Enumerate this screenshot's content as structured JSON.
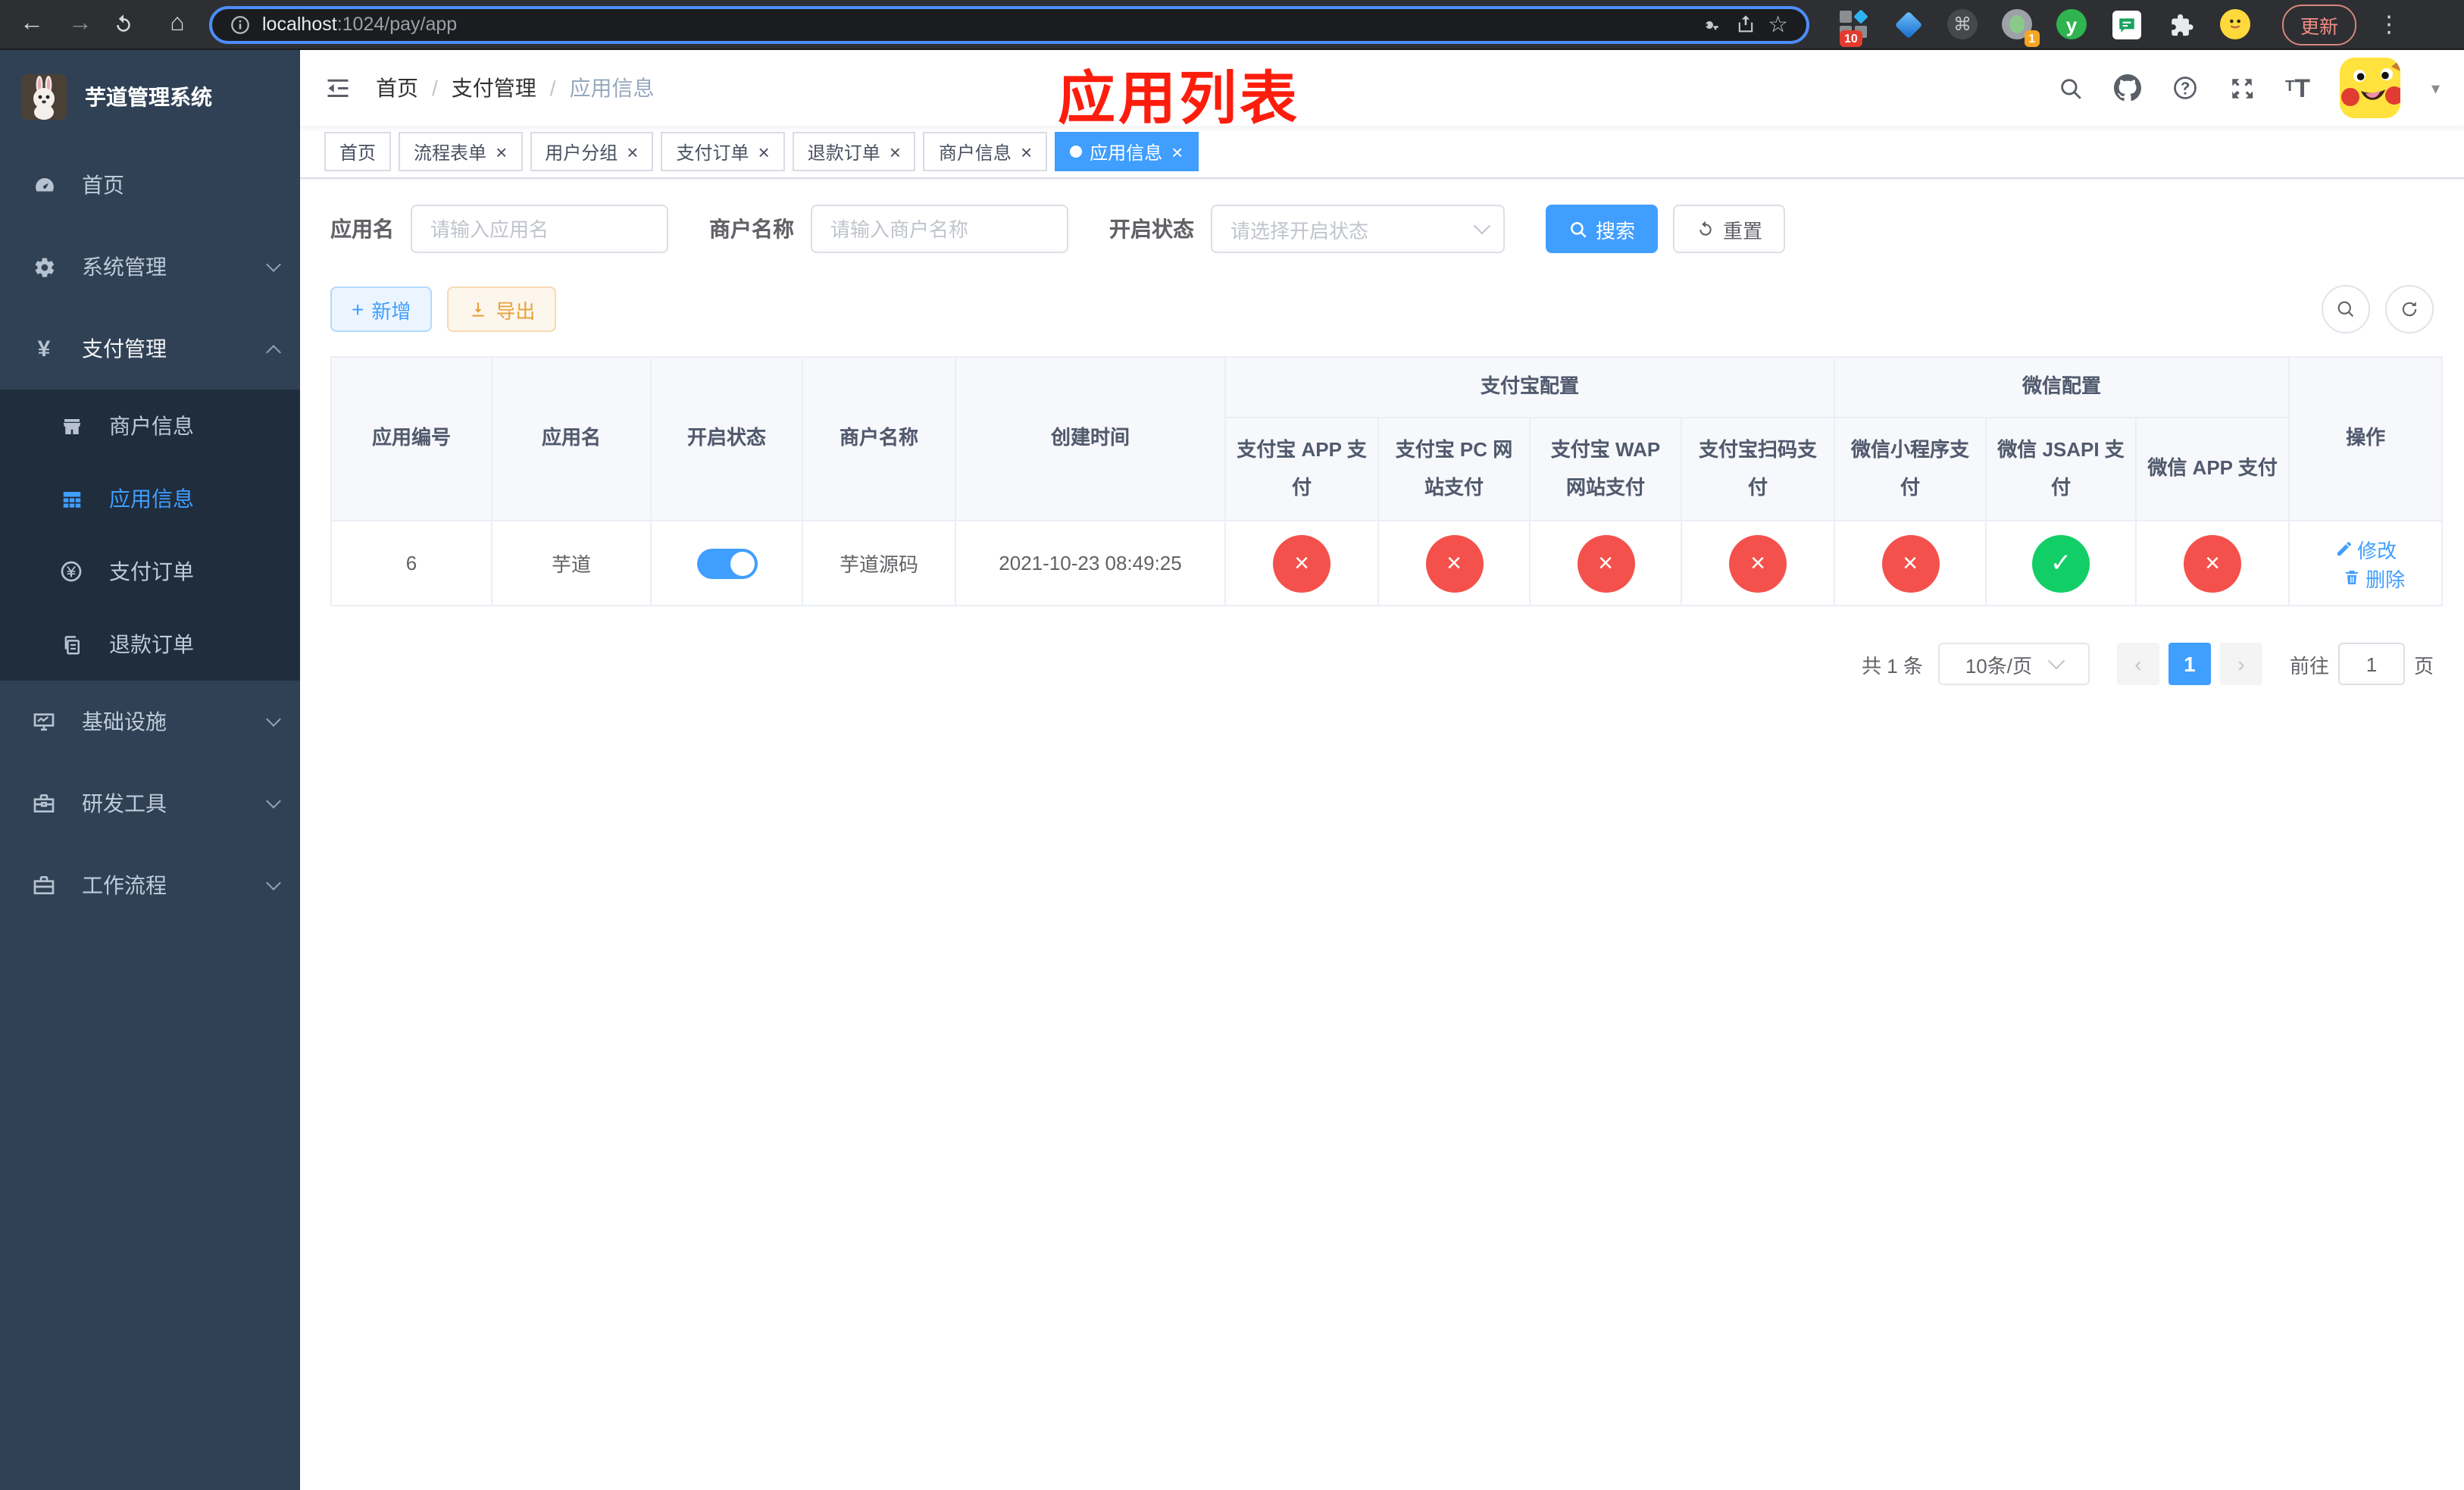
{
  "browser": {
    "back_icon": "←",
    "forward_icon": "→",
    "home_icon": "⌂",
    "url_host": "localhost",
    "url_path": ":1024/pay/app",
    "star_icon": "☆",
    "command_icon": "⌘",
    "ext_grid_badge": "10",
    "ext_circle_badge": "1",
    "ext_y_letter": "y",
    "update_label": "更新",
    "menu_dots_icon": "⋮"
  },
  "sidebar": {
    "logo_title": "芋道管理系统",
    "yen_icon": "¥",
    "menu": [
      {
        "label": "首页"
      },
      {
        "label": "系统管理"
      },
      {
        "label": "支付管理"
      },
      {
        "label": "商户信息"
      },
      {
        "label": "应用信息"
      },
      {
        "label": "支付订单"
      },
      {
        "label": "退款订单"
      },
      {
        "label": "基础设施"
      },
      {
        "label": "研发工具"
      },
      {
        "label": "工作流程"
      }
    ]
  },
  "header": {
    "breadcrumb": [
      {
        "label": "首页"
      },
      {
        "label": "支付管理"
      },
      {
        "label": "应用信息"
      }
    ],
    "separator": "/",
    "font_icon_letter": "T",
    "annotation": "应用列表"
  },
  "tabs": {
    "close_glyph": "×",
    "items": [
      {
        "label": "首页"
      },
      {
        "label": "流程表单"
      },
      {
        "label": "用户分组"
      },
      {
        "label": "支付订单"
      },
      {
        "label": "退款订单"
      },
      {
        "label": "商户信息"
      },
      {
        "label": "应用信息"
      }
    ]
  },
  "filters": {
    "app_name_label": "应用名",
    "app_name_placeholder": "请输入应用名",
    "merchant_label": "商户名称",
    "merchant_placeholder": "请输入商户名称",
    "status_label": "开启状态",
    "status_placeholder": "请选择开启状态",
    "search_label": "搜索",
    "reset_label": "重置"
  },
  "actions_toolbar": {
    "add_icon": "+",
    "add_label": "新增",
    "export_label": "导出"
  },
  "table": {
    "columns": {
      "app_id": "应用编号",
      "app_name": "应用名",
      "enabled": "开启状态",
      "merchant_name": "商户名称",
      "create_time": "创建时间",
      "alipay_group": "支付宝配置",
      "wechat_group": "微信配置",
      "alipay_app": "支付宝 APP 支付",
      "alipay_pc": "支付宝 PC 网站支付",
      "alipay_wap": "支付宝 WAP 网站支付",
      "alipay_qr": "支付宝扫码支付",
      "wechat_mini": "微信小程序支付",
      "wechat_jsapi": "微信 JSAPI 支付",
      "wechat_app": "微信 APP 支付",
      "ops": "操作"
    },
    "row": {
      "id": "6",
      "name": "芋道",
      "enabled_state": "on",
      "merchant": "芋道源码",
      "created": "2021-10-23 08:49:25",
      "configs": [
        {
          "name": "alipay-app-pay",
          "state": "off",
          "glyph": "×"
        },
        {
          "name": "alipay-pc-pay",
          "state": "off",
          "glyph": "×"
        },
        {
          "name": "alipay-wap-pay",
          "state": "off",
          "glyph": "×"
        },
        {
          "name": "alipay-qr-pay",
          "state": "off",
          "glyph": "×"
        },
        {
          "name": "wechat-mini-pay",
          "state": "off",
          "glyph": "×"
        },
        {
          "name": "wechat-jsapi-pay",
          "state": "on",
          "glyph": "✓"
        },
        {
          "name": "wechat-app-pay",
          "state": "off",
          "glyph": "×"
        }
      ],
      "edit_label": "修改",
      "delete_label": "删除"
    }
  },
  "pagination": {
    "total": "共 1 条",
    "page_size": "10条/页",
    "prev_icon": "‹",
    "current_page": "1",
    "next_icon": "›",
    "goto_label": "前往",
    "goto_value": "1",
    "unit_label": "页"
  }
}
